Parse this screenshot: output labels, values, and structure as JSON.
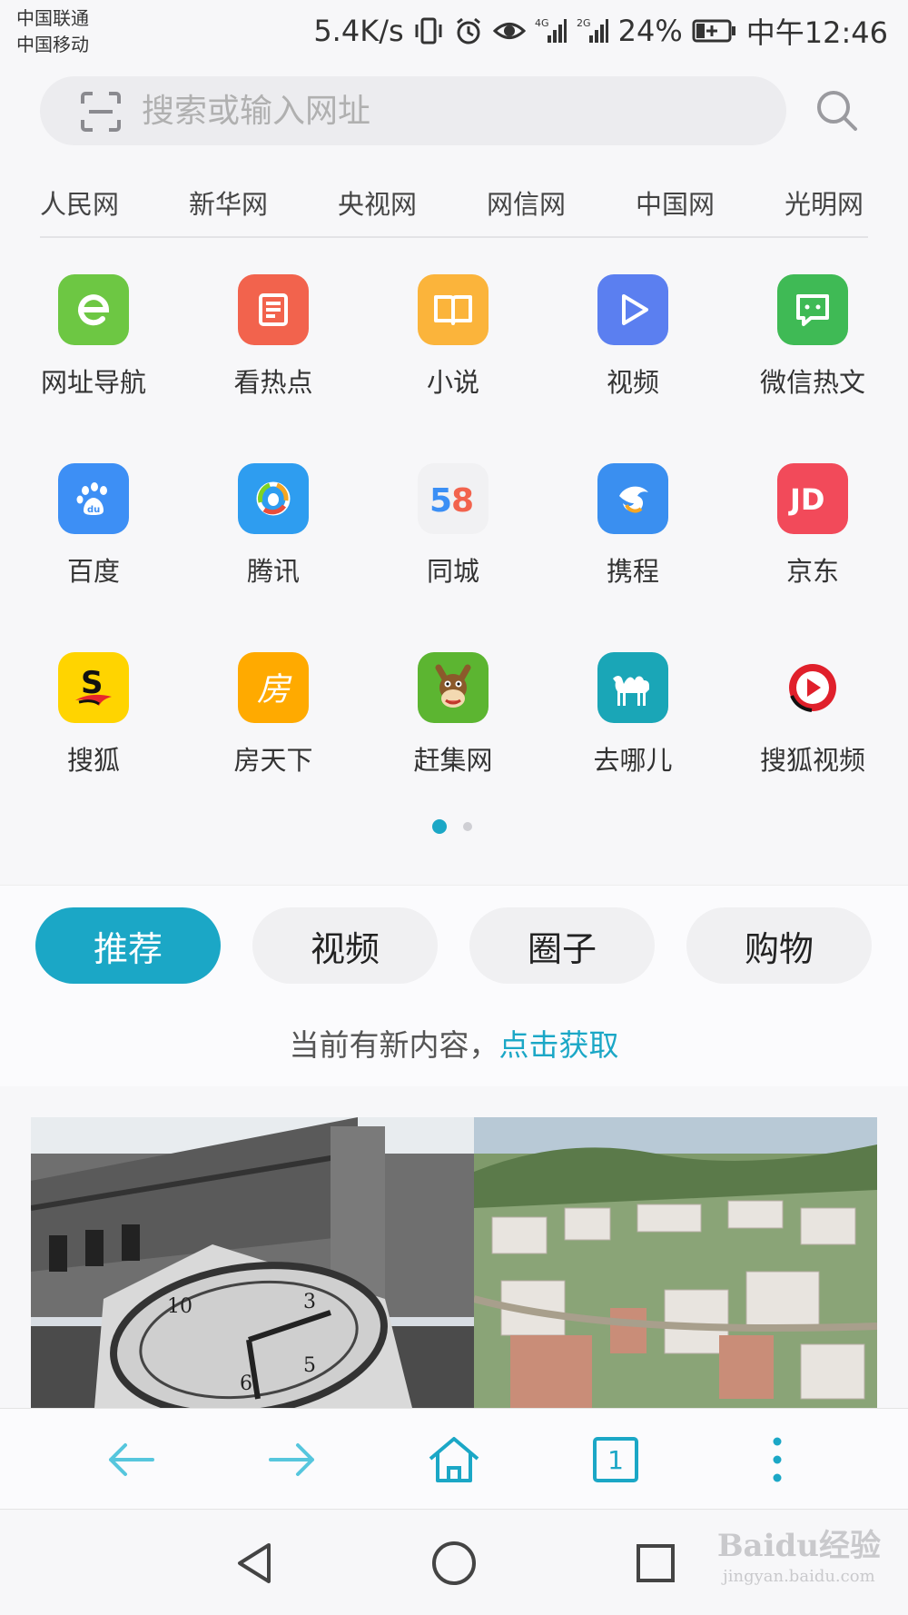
{
  "status_bar": {
    "carrier_1": "中国联通",
    "carrier_2": "中国移动",
    "net_speed": "5.4K/s",
    "battery": "24%",
    "time": "中午12:46",
    "icons": [
      "vibrate-icon",
      "alarm-icon",
      "eye-icon",
      "signal-4g-icon",
      "signal-2g-icon",
      "battery-charging-icon"
    ]
  },
  "search": {
    "placeholder": "搜索或输入网址"
  },
  "quick_links": [
    "人民网",
    "新华网",
    "央视网",
    "网信网",
    "中国网",
    "光明网"
  ],
  "apps": [
    {
      "label": "网址导航",
      "icon": "url-nav-icon",
      "color": "#6dc743"
    },
    {
      "label": "看热点",
      "icon": "hot-news-icon",
      "color": "#f2634d"
    },
    {
      "label": "小说",
      "icon": "novel-book-icon",
      "color": "#fbb43b"
    },
    {
      "label": "视频",
      "icon": "video-play-icon",
      "color": "#5b7ff0"
    },
    {
      "label": "微信热文",
      "icon": "wechat-article-icon",
      "color": "#3fba55"
    },
    {
      "label": "百度",
      "icon": "baidu-paw-icon",
      "color": "#3d8ff5"
    },
    {
      "label": "腾讯",
      "icon": "tencent-icon",
      "color": "#2e9df0"
    },
    {
      "label": "同城",
      "icon": "58-tongcheng-icon",
      "color": "#f1f1f3",
      "icon_text": "58"
    },
    {
      "label": "携程",
      "icon": "ctrip-dolphin-icon",
      "color": "#3a8ff0"
    },
    {
      "label": "京东",
      "icon": "jd-icon",
      "color": "#f24a5a",
      "icon_text": "JD"
    },
    {
      "label": "搜狐",
      "icon": "sohu-fox-icon",
      "color": "#ffd400",
      "icon_text": "S"
    },
    {
      "label": "房天下",
      "icon": "fang-house-icon",
      "color": "#ffaa00",
      "icon_text": "房"
    },
    {
      "label": "赶集网",
      "icon": "ganji-donkey-icon",
      "color": "#5cb531"
    },
    {
      "label": "去哪儿",
      "icon": "qunar-camel-icon",
      "color": "#1aa6b7"
    },
    {
      "label": "搜狐视频",
      "icon": "sohu-video-icon",
      "color": "#e0202b"
    }
  ],
  "pager": {
    "current": 1,
    "total": 2
  },
  "tabs": [
    {
      "label": "推荐",
      "active": true
    },
    {
      "label": "视频",
      "active": false
    },
    {
      "label": "圈子",
      "active": false
    },
    {
      "label": "购物",
      "active": false
    }
  ],
  "notice": {
    "text": "当前有新内容，",
    "link": "点击获取"
  },
  "toolbar": {
    "tab_count": "1",
    "icons": [
      "back-arrow-icon",
      "forward-arrow-icon",
      "home-icon",
      "tabs-icon",
      "more-menu-icon"
    ]
  },
  "system_nav": {
    "icons": [
      "nav-back-icon",
      "nav-home-icon",
      "nav-recents-icon"
    ]
  },
  "watermark": {
    "brand": "Baidu经验",
    "url": "jingyan.baidu.com"
  },
  "colors": {
    "accent": "#1ba7c6",
    "background": "#f7f7f9"
  }
}
